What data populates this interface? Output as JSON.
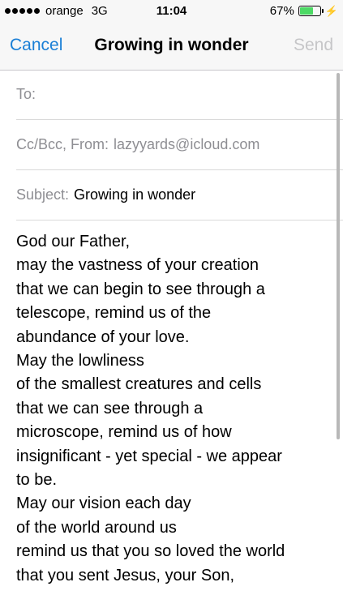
{
  "status_bar": {
    "carrier": "orange",
    "network": "3G",
    "time": "11:04",
    "battery_percent": "67%",
    "battery_level": 0.67
  },
  "nav": {
    "cancel": "Cancel",
    "title": "Growing in wonder",
    "send": "Send"
  },
  "fields": {
    "to_label": "To:",
    "cc_label": "Cc/Bcc, From:",
    "cc_value": "lazyyards@icloud.com",
    "subject_label": "Subject:",
    "subject_value": "Growing in wonder"
  },
  "body_lines": [
    "God our Father,",
    "may the vastness of your creation",
    "that we can begin to see through a",
    "telescope, remind us of the",
    "abundance of your love.",
    "May the lowliness",
    "of the smallest creatures and cells",
    "that we can see through a",
    "microscope, remind us of how",
    "insignificant - yet special - we appear",
    "to be.",
    "May our vision each day",
    "of the world around us",
    "remind us that you so loved the world",
    "that you sent Jesus, your Son,"
  ],
  "colors": {
    "accent": "#1a7fd6",
    "disabled": "#c6c6c8",
    "label_gray": "#8e8e93",
    "battery_green": "#4cd964"
  }
}
